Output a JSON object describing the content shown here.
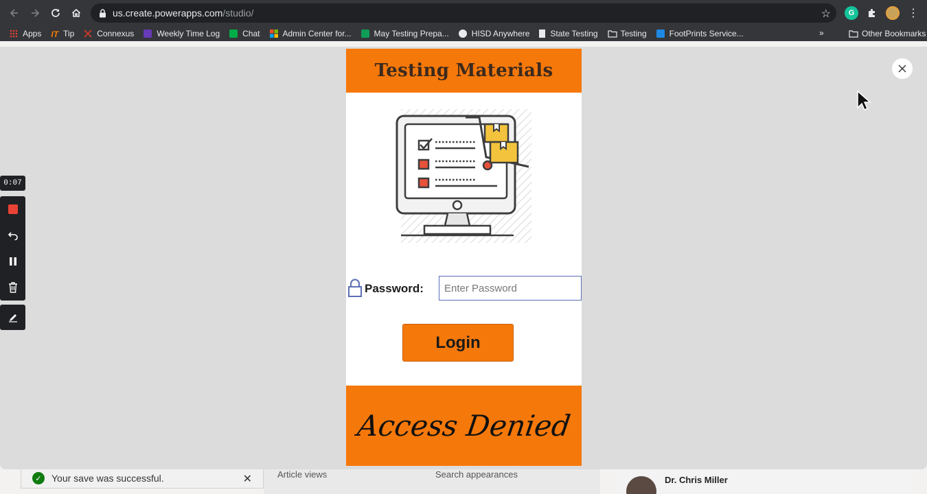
{
  "browser": {
    "url_host": "us.create.powerapps.com",
    "url_path": "/studio/",
    "extension_g_letter": "G",
    "bookmarks": [
      {
        "label": "Apps",
        "icon": "apps-grid-icon"
      },
      {
        "label": "Tip",
        "icon": "it-icon",
        "prefix": "IT"
      },
      {
        "label": "Connexus",
        "icon": "connexus-icon"
      },
      {
        "label": "Weekly Time Log",
        "icon": "form-icon"
      },
      {
        "label": "Chat",
        "icon": "chat-icon"
      },
      {
        "label": "Admin Center for...",
        "icon": "microsoft-icon"
      },
      {
        "label": "May Testing Prepa...",
        "icon": "sheets-icon"
      },
      {
        "label": "HISD Anywhere",
        "icon": "globe-icon"
      },
      {
        "label": "State Testing",
        "icon": "doc-icon"
      },
      {
        "label": "Testing",
        "icon": "folder-icon"
      },
      {
        "label": "FootPrints Service...",
        "icon": "footprints-icon"
      }
    ],
    "more_label": "»",
    "other_bookmarks": "Other Bookmarks"
  },
  "recorder": {
    "time": "0:07"
  },
  "app": {
    "title": "Testing Materials",
    "password_label": "Password:",
    "password_placeholder": "Enter Password",
    "login_label": "Login",
    "status_text": "Access Denied",
    "accent_color": "#f5780a"
  },
  "background": {
    "toast_text": "Your save was successful.",
    "col_article_views": "Article views",
    "col_search_appearances": "Search appearances",
    "person_name": "Dr. Chris Miller"
  }
}
